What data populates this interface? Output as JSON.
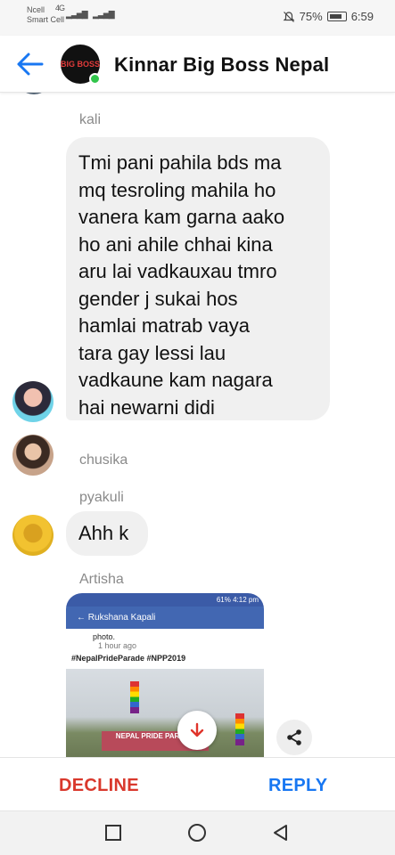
{
  "status_bar": {
    "carrier": "Ncell",
    "carrier2": "Smart Cell",
    "network": "4G",
    "battery": "75%",
    "time": "6:59"
  },
  "header": {
    "title": "Kinnar Big Boss Nepal",
    "avatar_logo": "BIG BOSS",
    "online": true,
    "accent": "#1877f2"
  },
  "messages": [
    {
      "sender": "kali",
      "text": "Tmi pani pahila bds ma\nmq tesroling mahila ho\nvanera kam garna aako\nho ani ahile chhai kina\naru lai vadkauxau tmro\ngender j sukai hos\nhamlai matrab vaya\ntara gay lessi lau\nvadkaune kam nagara\nhai newarni didi"
    },
    {
      "sender": "chusika",
      "text": ""
    },
    {
      "sender": "pyakuli",
      "text": "Ahh k"
    },
    {
      "sender": "Artisha",
      "text": ""
    }
  ],
  "attachment": {
    "status_text": "61% 4:12 pm",
    "profile_name": "Rukshana Kapali",
    "post_word": "photo.",
    "time_ago": "1 hour ago",
    "hashtags": "#NepalPrideParade #NPP2019",
    "banner_text": "NEPAL PRIDE PARADE"
  },
  "actions": {
    "decline": "DECLINE",
    "reply": "REPLY",
    "decline_color": "#d9382c",
    "reply_color": "#1877f2"
  },
  "icons": {
    "back": "arrow-left-icon",
    "down": "arrow-down-icon",
    "share": "share-icon",
    "recents": "square-icon",
    "home": "circle-icon",
    "nav_back": "triangle-back-icon"
  }
}
